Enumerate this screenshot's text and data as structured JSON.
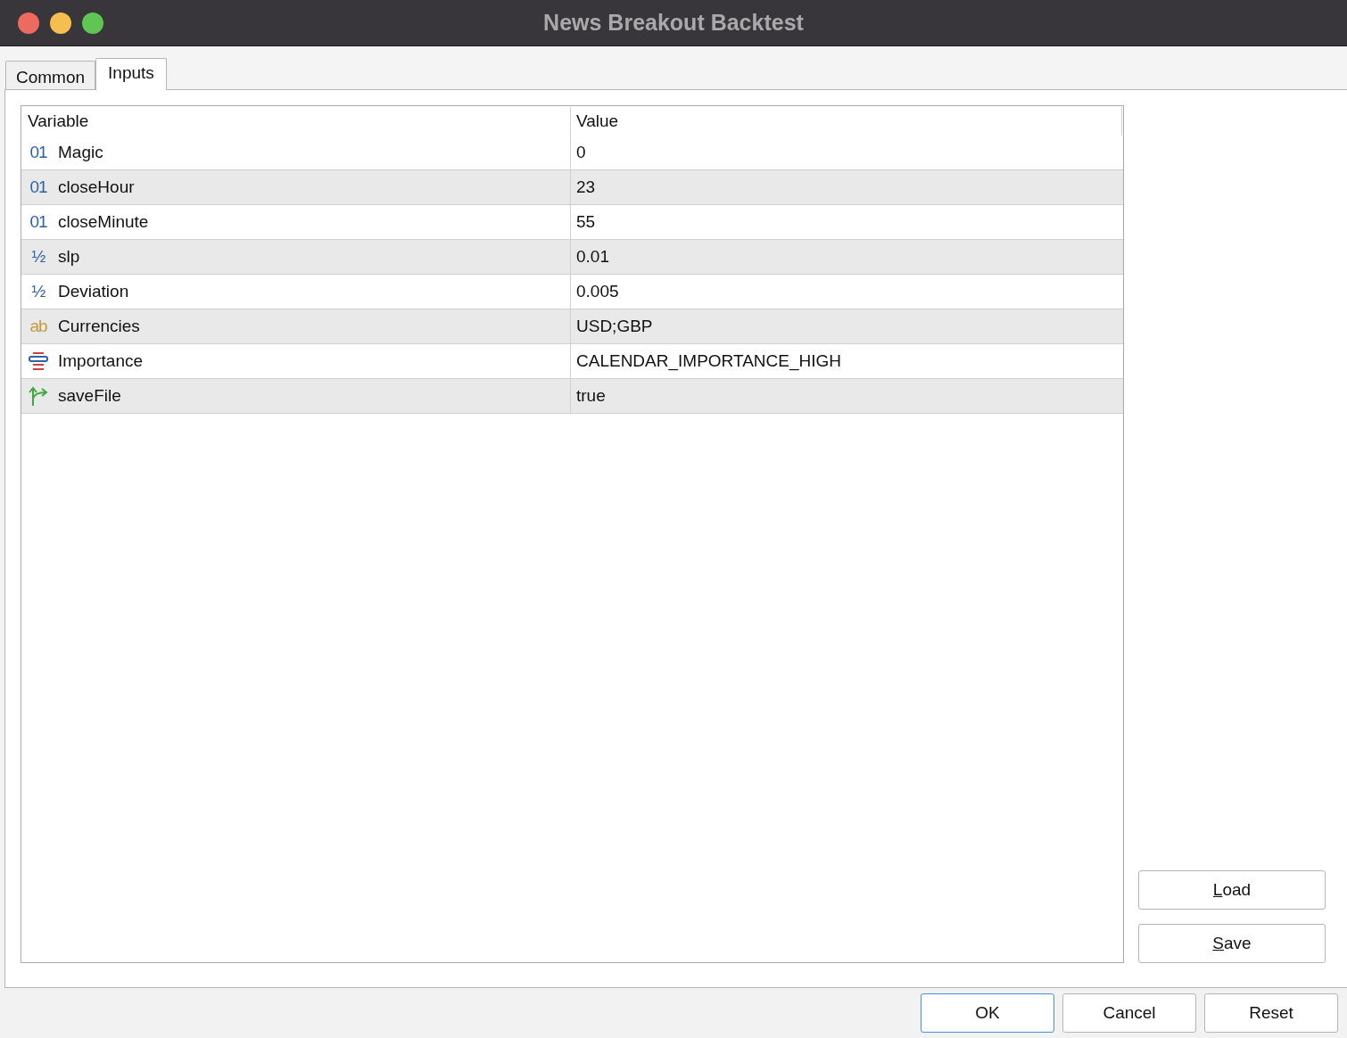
{
  "window": {
    "title": "News Breakout Backtest"
  },
  "tabs": [
    {
      "label": "Common",
      "selected": false
    },
    {
      "label": "Inputs",
      "selected": true
    }
  ],
  "table": {
    "columns": [
      "Variable",
      "Value"
    ],
    "rows": [
      {
        "kind": "glyph",
        "icon": "01",
        "color": "#2d62a6",
        "variable": "Magic",
        "value": "0"
      },
      {
        "kind": "glyph",
        "icon": "01",
        "color": "#2d62a6",
        "variable": "closeHour",
        "value": "23"
      },
      {
        "kind": "glyph",
        "icon": "01",
        "color": "#2d62a6",
        "variable": "closeMinute",
        "value": "55"
      },
      {
        "kind": "glyph",
        "icon": "½",
        "color": "#2d62a6",
        "variable": "slp",
        "value": "0.01"
      },
      {
        "kind": "glyph",
        "icon": "½",
        "color": "#2d62a6",
        "variable": "Deviation",
        "value": "0.005"
      },
      {
        "kind": "glyph",
        "icon": "ab",
        "color": "#c49a3c",
        "variable": "Currencies",
        "value": "USD;GBP"
      },
      {
        "kind": "enum",
        "variable": "Importance",
        "value": "CALENDAR_IMPORTANCE_HIGH"
      },
      {
        "kind": "bool",
        "variable": "saveFile",
        "value": "true"
      }
    ]
  },
  "side_buttons": [
    {
      "label": "Load",
      "underline_first": true
    },
    {
      "label": "Save",
      "underline_first": true
    }
  ],
  "footer_buttons": [
    {
      "label": "OK",
      "default": true
    },
    {
      "label": "Cancel",
      "default": false
    },
    {
      "label": "Reset",
      "default": false
    }
  ]
}
